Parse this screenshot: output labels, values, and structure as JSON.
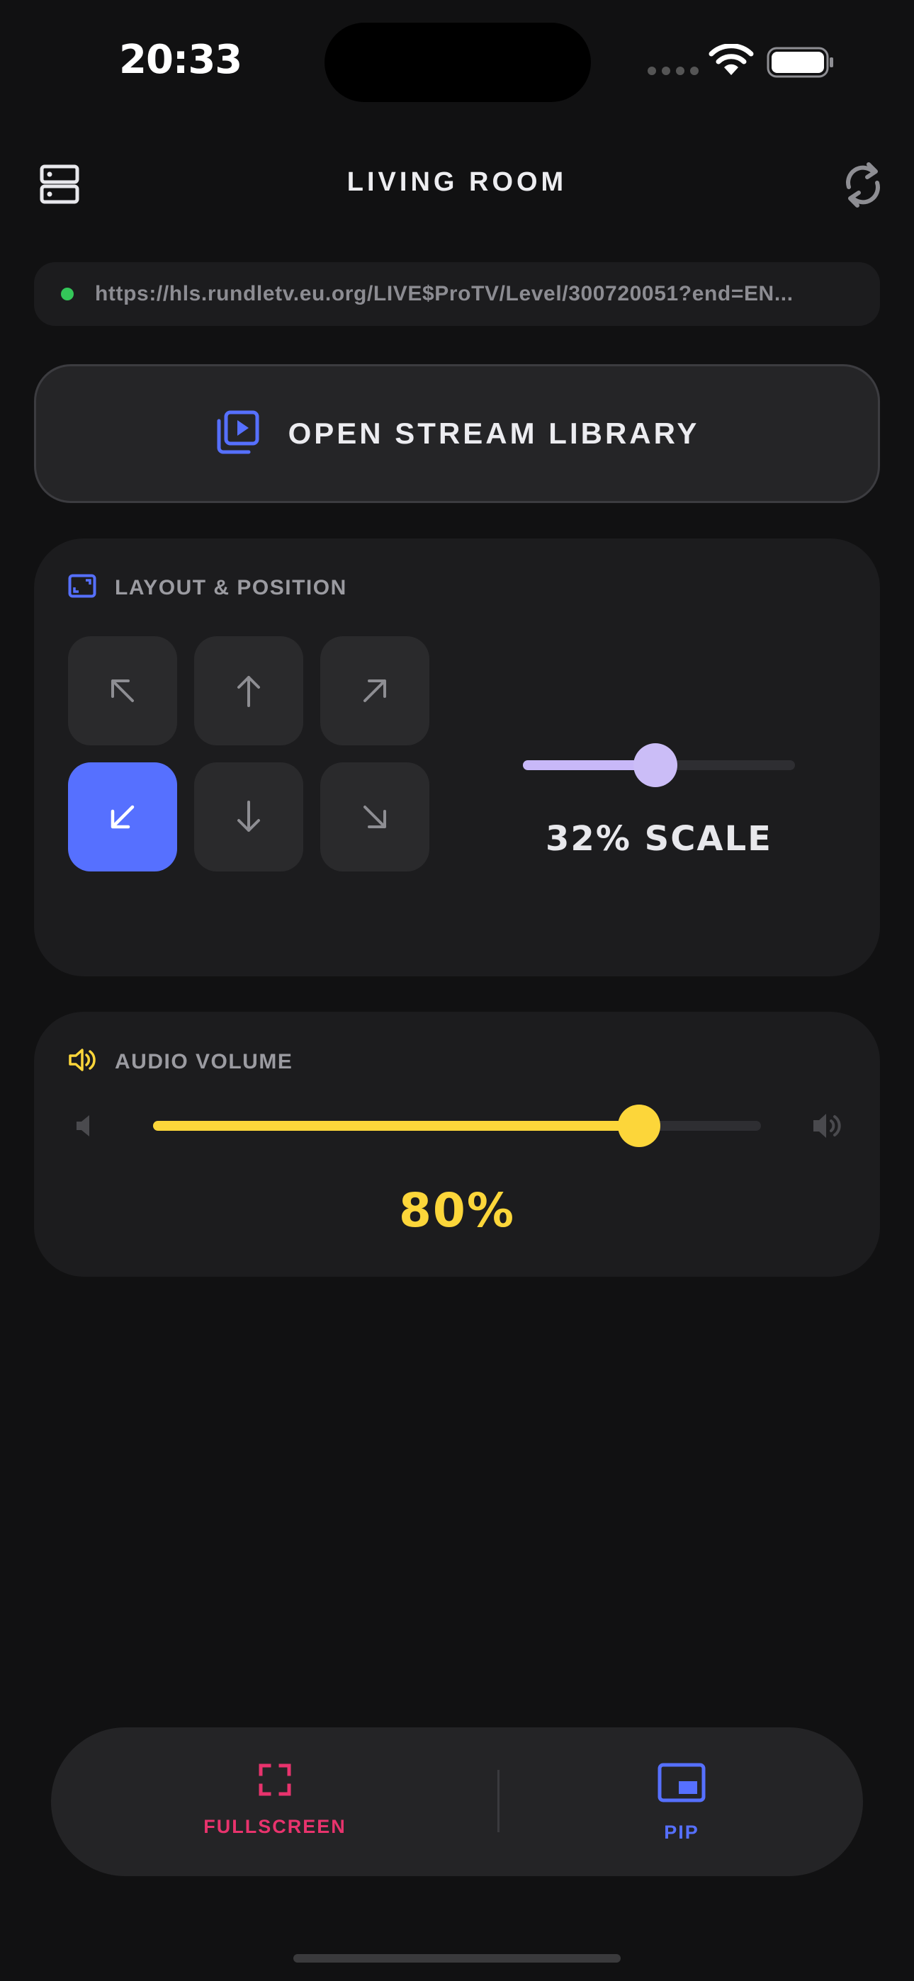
{
  "status_bar": {
    "time": "20:33"
  },
  "header": {
    "title": "LIVING ROOM",
    "left_icon": "server-stack-icon",
    "right_icon": "refresh-icon"
  },
  "stream_url": {
    "text": "https://hls.rundletv.eu.org/LIVE$ProTV/Level/300720051?end=EN...",
    "status_color": "#34c759"
  },
  "library_button": {
    "label": "OPEN STREAM LIBRARY",
    "icon": "video-library-icon"
  },
  "layout_section": {
    "label": "LAYOUT & POSITION",
    "icon": "picture-in-picture-frame-icon",
    "positions": [
      {
        "icon": "arrow-up-left-icon",
        "active": false
      },
      {
        "icon": "arrow-up-icon",
        "active": false
      },
      {
        "icon": "arrow-up-right-icon",
        "active": false
      },
      {
        "icon": "arrow-down-left-icon",
        "active": true
      },
      {
        "icon": "arrow-down-icon",
        "active": false
      },
      {
        "icon": "arrow-down-right-icon",
        "active": false
      }
    ],
    "scale": {
      "value": 0.32,
      "label": "32% SCALE"
    }
  },
  "audio_section": {
    "label": "AUDIO VOLUME",
    "icon": "speaker-icon",
    "volume": {
      "value": 0.8,
      "label": "80%"
    }
  },
  "bottom_bar": {
    "fullscreen": {
      "label": "FULLSCREEN",
      "color": "#e8336d"
    },
    "pip": {
      "label": "PIP",
      "color": "#5670ff"
    }
  },
  "colors": {
    "accent_blue": "#5670ff",
    "accent_yellow": "#fcd63a",
    "accent_lavender": "#cbbdf7",
    "background": "#111112",
    "card": "#1c1c1e"
  }
}
